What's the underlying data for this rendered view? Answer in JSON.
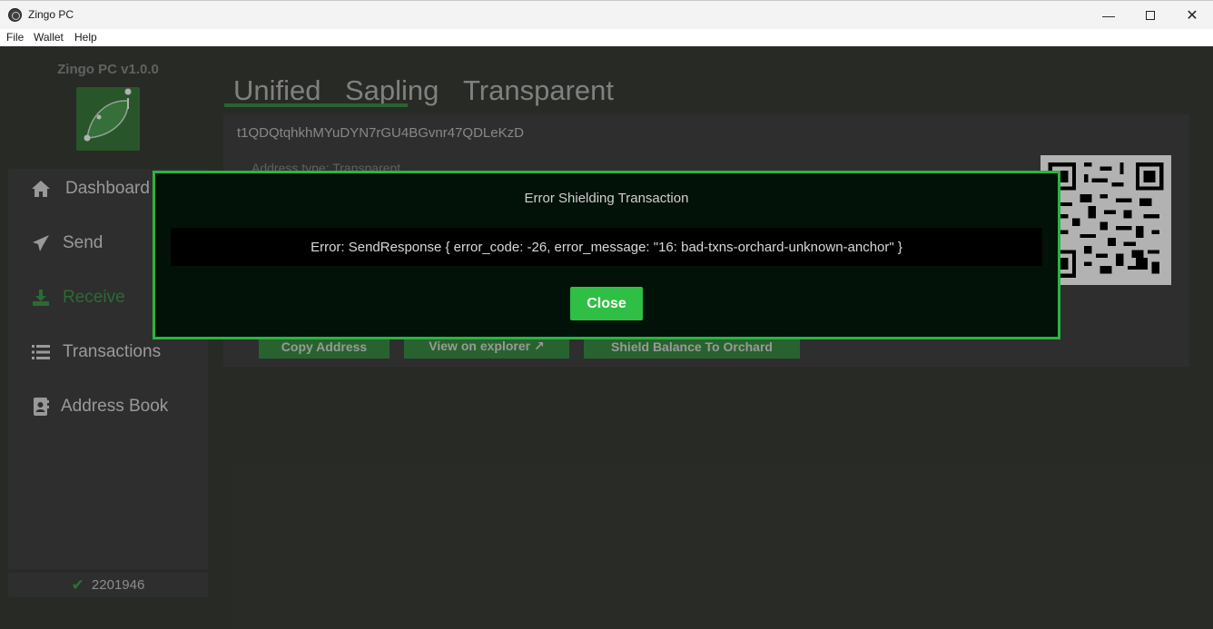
{
  "window": {
    "title": "Zingo PC",
    "minimize": "—",
    "close": "✕"
  },
  "menu": {
    "file": "File",
    "wallet": "Wallet",
    "help": "Help"
  },
  "sidebar": {
    "version": "Zingo PC v1.0.0",
    "items": [
      {
        "label": "Dashboard",
        "icon": "home-icon"
      },
      {
        "label": "Send",
        "icon": "paper-plane-icon"
      },
      {
        "label": "Receive",
        "icon": "download-icon",
        "active": true
      },
      {
        "label": "Transactions",
        "icon": "list-icon"
      },
      {
        "label": "Address Book",
        "icon": "address-book-icon"
      }
    ],
    "block_height": "2201946"
  },
  "receive": {
    "tabs": [
      "Unified",
      "Sapling",
      "Transparent"
    ],
    "active_tab": "Transparent",
    "address": "t1QDQtqhkhMYuDYN7rGU4BGvnr47QDLeKzD",
    "address_type": "Address type: Transparent",
    "buttons": {
      "copy": "Copy Address",
      "explorer": "View on explorer ↗",
      "shield": "Shield Balance To Orchard"
    }
  },
  "modal": {
    "title": "Error Shielding Transaction",
    "message": "Error: SendResponse { error_code: -26, error_message: \"16: bad-txns-orchard-unknown-anchor\" }",
    "close_label": "Close"
  },
  "colors": {
    "accent": "#2bb442",
    "sidebar_bg": "#434343",
    "window_bg": "#3a3d37",
    "modal_bg": "#021209"
  }
}
